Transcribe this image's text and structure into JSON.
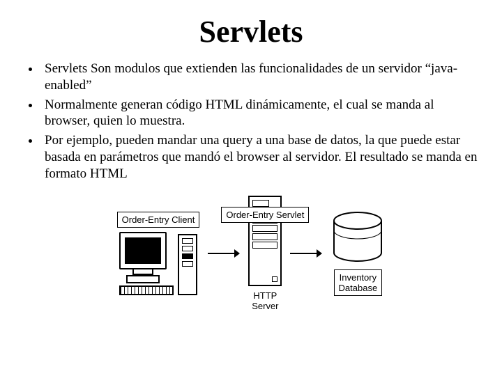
{
  "title": "Servlets",
  "bullets": [
    "Servlets Son modulos que extienden las funcionalidades de un servidor “java-enabled”",
    "Normalmente generan código HTML dinámicamente, el cual se manda al browser, quien lo muestra.",
    "Por ejemplo, pueden mandar una query a una base de datos, la que puede estar basada en parámetros que mandó el browser al servidor. El resultado se manda en formato HTML"
  ],
  "diagram": {
    "client_label": "Order-Entry Client",
    "servlet_label": "Order-Entry Servlet",
    "server_caption": "HTTP\nServer",
    "db_label": "Inventory\nDatabase"
  }
}
